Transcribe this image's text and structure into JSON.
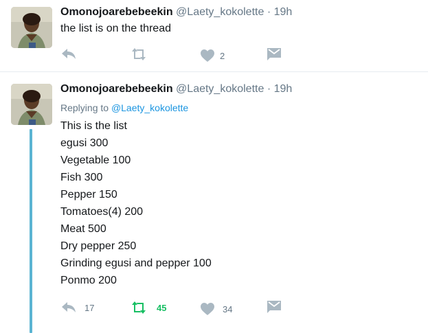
{
  "tweets": [
    {
      "display_name": "Omonojoarebebeekin",
      "handle": "@Laety_kokolette",
      "separator": "·",
      "time": "19h",
      "text_lines": [
        "the list is on the thread"
      ],
      "actions": {
        "reply_count": "",
        "retweet_count": "",
        "like_count": "2"
      }
    },
    {
      "display_name": "Omonojoarebebeekin",
      "handle": "@Laety_kokolette",
      "separator": "·",
      "time": "19h",
      "replying_prefix": "Replying to",
      "replying_handle": "@Laety_kokolette",
      "text_lines": [
        "This is the list",
        "egusi 300",
        "Vegetable 100",
        "Fish 300",
        "Pepper 150",
        "Tomatoes(4) 200",
        "Meat 500",
        "Dry pepper 250",
        "Grinding egusi and pepper 100",
        "Ponmo 200"
      ],
      "actions": {
        "reply_count": "17",
        "retweet_count": "45",
        "like_count": "34"
      }
    }
  ],
  "icons": {
    "reply": "reply-icon",
    "retweet": "retweet-icon",
    "like": "heart-icon",
    "dm": "direct-message-icon"
  },
  "colors": {
    "name": "#14171a",
    "muted": "#657786",
    "link": "#1b95e0",
    "retweeted": "#17bf63",
    "thread_line": "#5ab4d2",
    "icon_gray": "#aab8c2"
  }
}
